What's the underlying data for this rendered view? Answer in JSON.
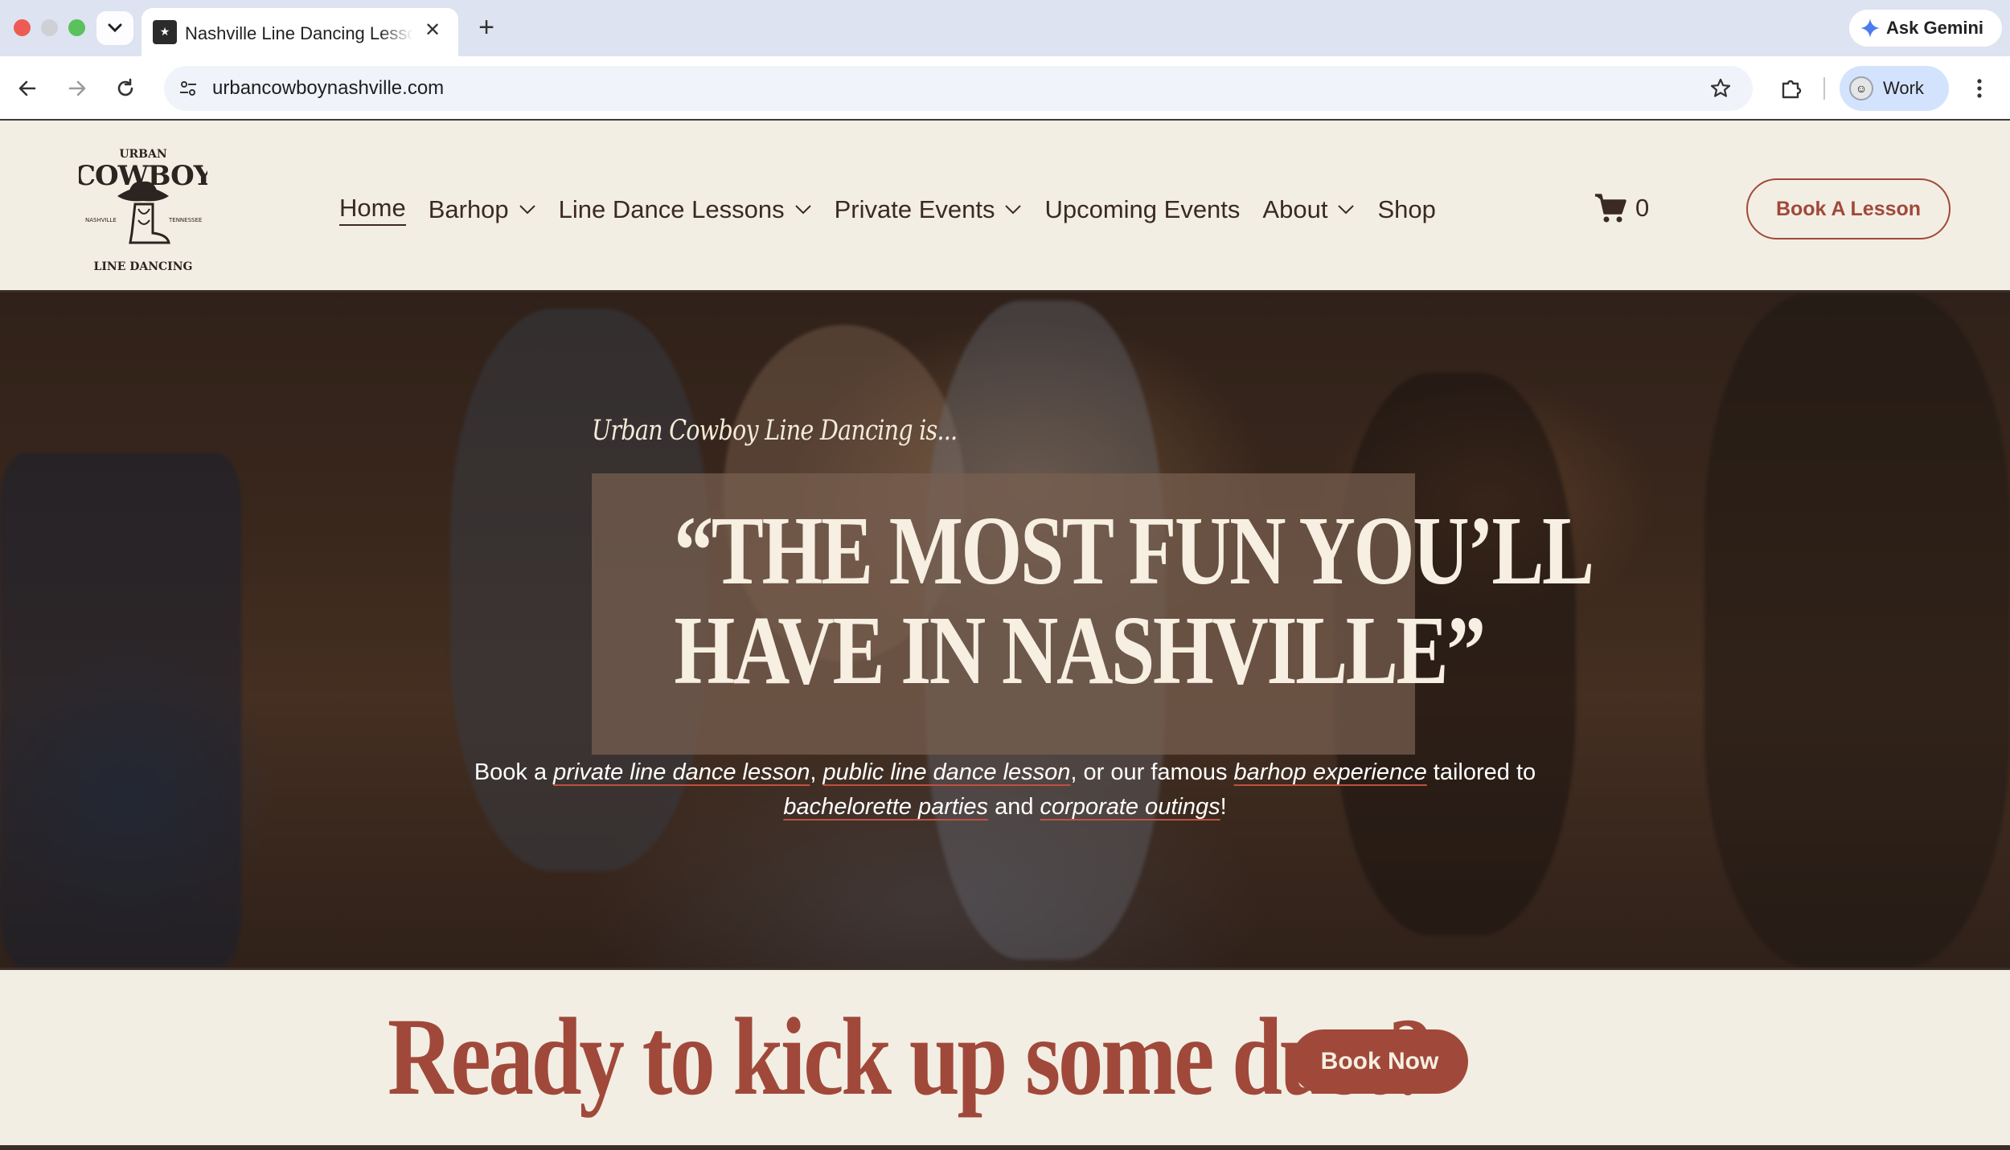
{
  "browser": {
    "tab": {
      "title": "Nashville Line Dancing Lessons"
    },
    "url": "urbancowboynashville.com",
    "ask_gemini": "Ask Gemini",
    "profile": "Work"
  },
  "header": {
    "logo": {
      "top": "URBAN",
      "main": "COWBOY",
      "left": "NASHVILLE",
      "right": "TENNESSEE",
      "bottom": "LINE DANCING"
    },
    "nav": [
      {
        "label": "Home",
        "active": true,
        "dropdown": false
      },
      {
        "label": "Barhop",
        "dropdown": true
      },
      {
        "label": "Line Dance Lessons",
        "dropdown": true
      },
      {
        "label": "Private Events",
        "dropdown": true
      },
      {
        "label": "Upcoming Events",
        "dropdown": false
      },
      {
        "label": "About",
        "dropdown": true
      },
      {
        "label": "Shop",
        "dropdown": false
      }
    ],
    "cart_count": "0",
    "cta_label": "Book A Lesson"
  },
  "hero": {
    "kicker": "Urban Cowboy Line Dancing is...",
    "headline_line1": "“THE MOST FUN YOU’LL",
    "headline_line2": "HAVE IN NASHVILLE”",
    "sub": {
      "t1": "Book a ",
      "link1": "private line dance lesson",
      "t2": ", ",
      "link2": "public line dance lesson",
      "t3": ", or our famous ",
      "link3": "barhop experience",
      "t4": " tailored to ",
      "link4": "bachelorette parties",
      "t5": " and ",
      "link5": "corporate outings",
      "t6": "!"
    }
  },
  "cta": {
    "title": "Ready to kick up some dust?",
    "button": "Book Now"
  },
  "colors": {
    "brand_rust": "#a0493a",
    "cream": "#f3eee4",
    "dark_brown": "#3a2a22"
  }
}
